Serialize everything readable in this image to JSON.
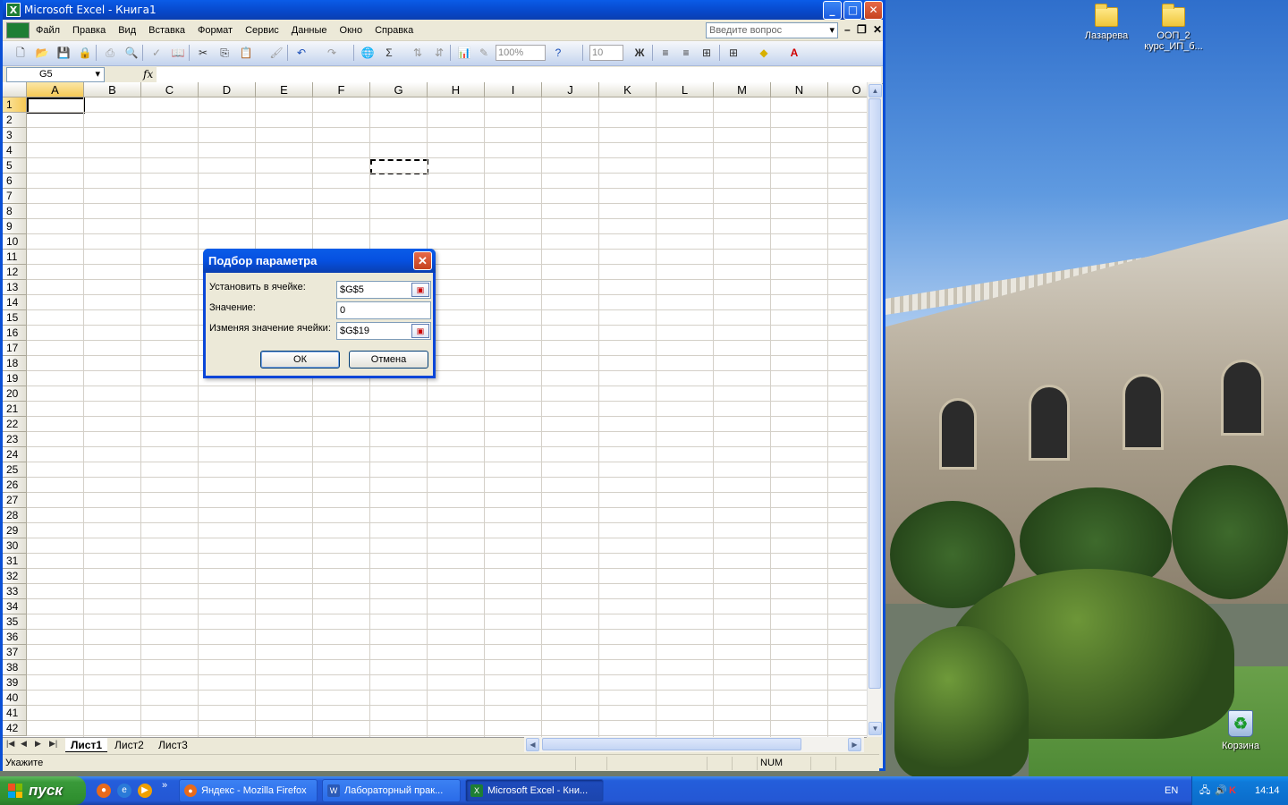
{
  "desktop": {
    "icons": [
      {
        "label": "Лазарева"
      },
      {
        "label": "ООП_2 курс_ИП_б..."
      },
      {
        "label": "Корзина"
      }
    ]
  },
  "excel": {
    "title": "Microsoft Excel - Книга1",
    "menu": [
      "Файл",
      "Правка",
      "Вид",
      "Вставка",
      "Формат",
      "Сервис",
      "Данные",
      "Окно",
      "Справка"
    ],
    "ask_placeholder": "Введите вопрос",
    "zoom": "100%",
    "font_size": "10",
    "bold_label": "Ж",
    "name_box": "G5",
    "fx_label": "fx",
    "columns": [
      "A",
      "B",
      "C",
      "D",
      "E",
      "F",
      "G",
      "H",
      "I",
      "J",
      "K",
      "L",
      "M",
      "N",
      "O"
    ],
    "rows": [
      "1",
      "2",
      "3",
      "4",
      "5",
      "6",
      "7",
      "8",
      "9",
      "10",
      "11",
      "12",
      "13",
      "14",
      "15",
      "16",
      "17",
      "18",
      "19",
      "20",
      "21",
      "22",
      "23",
      "24",
      "25",
      "26",
      "27",
      "28",
      "29",
      "30",
      "31",
      "32",
      "33",
      "34",
      "35",
      "36",
      "37",
      "38",
      "39",
      "40",
      "41",
      "42"
    ],
    "sheet_tabs": [
      "Лист1",
      "Лист2",
      "Лист3"
    ],
    "status_text": "Укажите",
    "status_num": "NUM"
  },
  "dialog": {
    "title": "Подбор параметра",
    "set_cell_label": "Установить в ячейке:",
    "set_cell_value": "$G$5",
    "value_label": "Значение:",
    "value_value": "0",
    "changing_label": "Изменяя значение ячейки:",
    "changing_value": "$G$19",
    "ok_label": "ОК",
    "cancel_label": "Отмена"
  },
  "taskbar": {
    "start_label": "пуск",
    "tasks": [
      {
        "label": "Яндекс - Mozilla Firefox"
      },
      {
        "label": "Лабораторный прак..."
      },
      {
        "label": "Microsoft Excel - Кни..."
      }
    ],
    "language": "EN",
    "clock": "14:14"
  }
}
